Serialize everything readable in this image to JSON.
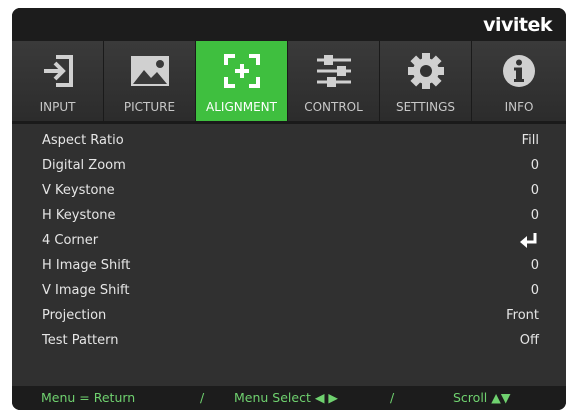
{
  "brand": "vivitek",
  "tabs": [
    {
      "label": "INPUT",
      "icon": "input-icon",
      "active": false
    },
    {
      "label": "PICTURE",
      "icon": "picture-icon",
      "active": false
    },
    {
      "label": "ALIGNMENT",
      "icon": "alignment-icon",
      "active": true
    },
    {
      "label": "CONTROL",
      "icon": "control-icon",
      "active": false
    },
    {
      "label": "SETTINGS",
      "icon": "settings-icon",
      "active": false
    },
    {
      "label": "INFO",
      "icon": "info-icon",
      "active": false
    }
  ],
  "menu": [
    {
      "label": "Aspect Ratio",
      "value": "Fill"
    },
    {
      "label": "Digital Zoom",
      "value": "0"
    },
    {
      "label": "V Keystone",
      "value": "0"
    },
    {
      "label": "H Keystone",
      "value": "0"
    },
    {
      "label": "4 Corner",
      "value": "",
      "value_icon": "enter-icon"
    },
    {
      "label": "H Image Shift",
      "value": "0"
    },
    {
      "label": "V Image Shift",
      "value": "0"
    },
    {
      "label": "Projection",
      "value": "Front"
    },
    {
      "label": "Test Pattern",
      "value": "Off"
    }
  ],
  "footer": {
    "menu_return": "Menu = Return",
    "slash1": "/",
    "menu_select": "Menu Select ◀ ▶",
    "slash2": "/",
    "scroll": "Scroll ▲▼"
  },
  "colors": {
    "accent": "#3fbf3f",
    "hint_text": "#6fd16f",
    "panel_bg": "#303030"
  }
}
